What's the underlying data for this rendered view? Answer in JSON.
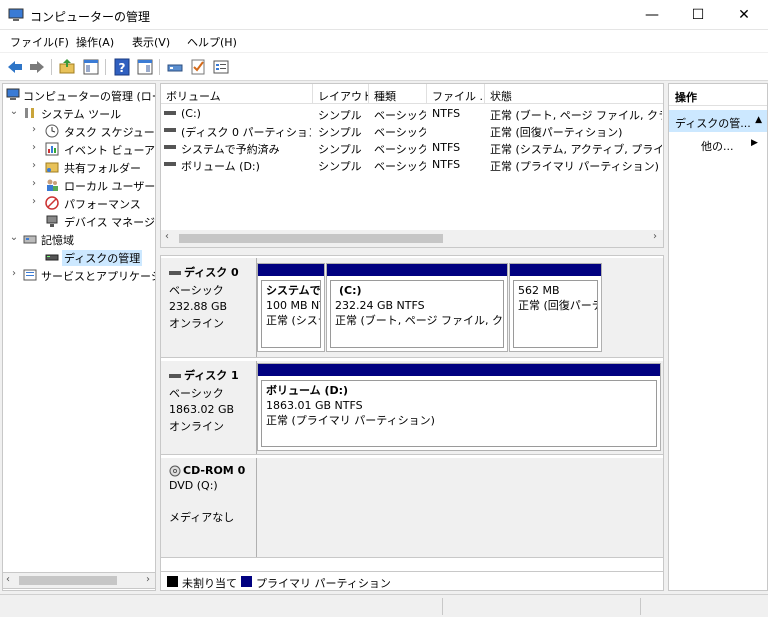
{
  "window": {
    "title": "コンピューターの管理",
    "minimize_glyph": "—",
    "maximize_glyph": "☐",
    "close_glyph": "✕"
  },
  "menu": [
    "ファイル(F)",
    "操作(A)",
    "表示(V)",
    "ヘルプ(H)"
  ],
  "toolbar_icons": [
    "back-icon",
    "forward-icon",
    "up-folder-icon",
    "show-tree-icon",
    "help-icon",
    "show-pane-icon",
    "connect-icon",
    "check-icon",
    "properties-icon"
  ],
  "tree": {
    "root": "コンピューターの管理 (ローカ",
    "system_tools": "システム ツール",
    "task_scheduler": "タスク スケジューラ",
    "event_viewer": "イベント ビューアー",
    "shared_folders": "共有フォルダー",
    "local_users": "ローカル ユーザーとグ",
    "performance": "パフォーマンス",
    "device_manager": "デバイス マネージャー",
    "storage": "記憶域",
    "disk_management": "ディスクの管理",
    "services": "サービスとアプリケーション"
  },
  "volume_list": {
    "columns": [
      "ボリューム",
      "レイアウト",
      "種類",
      "ファイル ...",
      "状態"
    ],
    "rows": [
      [
        "(C:)",
        "シンプル",
        "ベーシック",
        "NTFS",
        "正常 (ブート, ページ ファイル, クラッシュ"
      ],
      [
        "(ディスク 0 パーティション 3)",
        "シンプル",
        "ベーシック",
        "",
        "正常 (回復パーティション)"
      ],
      [
        "システムで予約済み",
        "シンプル",
        "ベーシック",
        "NTFS",
        "正常 (システム, アクティブ, プライマリ パ"
      ],
      [
        "ボリューム (D:)",
        "シンプル",
        "ベーシック",
        "NTFS",
        "正常 (プライマリ パーティション)"
      ]
    ]
  },
  "disks": {
    "disk0": {
      "name": "ディスク 0",
      "type": "ベーシック",
      "size": "232.88 GB",
      "status": "オンライン",
      "partitions": [
        {
          "title": "システムで予",
          "size": "100 MB NTFS",
          "status": "正常 (システ"
        },
        {
          "title": "(C:)",
          "size": "232.24 GB NTFS",
          "status": "正常 (ブート, ページ ファイル, クラッシ"
        },
        {
          "title": "",
          "size": "562 MB",
          "status": "正常 (回復パーティ"
        }
      ]
    },
    "disk1": {
      "name": "ディスク 1",
      "type": "ベーシック",
      "size": "1863.02 GB",
      "status": "オンライン",
      "partitions": [
        {
          "title": "ボリューム  (D:)",
          "size": "1863.01 GB NTFS",
          "status": "正常 (プライマリ パーティション)"
        }
      ]
    },
    "cdrom0": {
      "name": "CD-ROM 0",
      "type": "DVD (Q:)",
      "media": "メディアなし"
    }
  },
  "legend": {
    "unallocated": "未割り当て",
    "primary": "プライマリ パーティション",
    "unallocated_color": "#000000",
    "primary_color": "#000080"
  },
  "actions": {
    "header": "操作",
    "section": "ディスクの管...",
    "more": "他の..."
  }
}
